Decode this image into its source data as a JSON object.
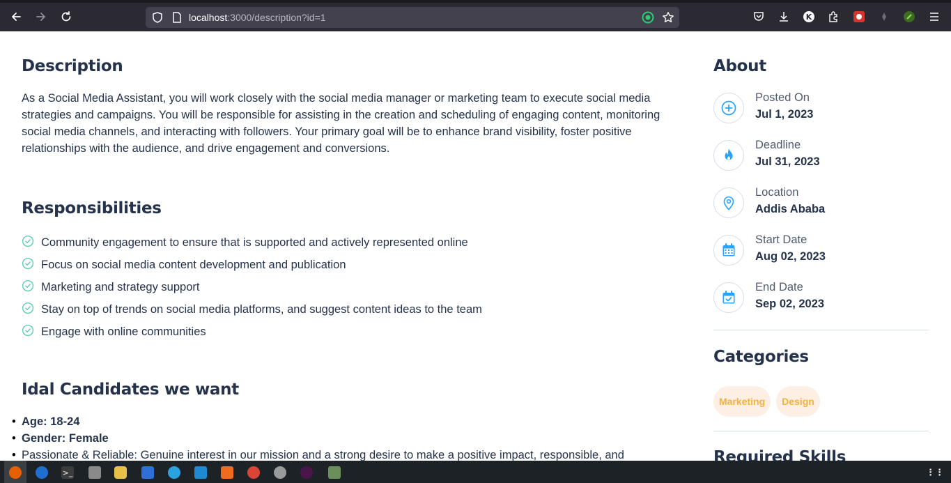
{
  "browser": {
    "url_host": "localhost",
    "url_path": ":3000/description?id=1"
  },
  "description": {
    "title": "Description",
    "text": "As a Social Media Assistant, you will work closely with the social media manager or marketing team to execute social media strategies and campaigns. You will be responsible for assisting in the creation and scheduling of engaging content, monitoring social media channels, and interacting with followers. Your primary goal will be to enhance brand visibility, foster positive relationships with the audience, and drive engagement and conversions."
  },
  "responsibilities": {
    "title": "Responsibilities",
    "items": [
      "Community engagement to ensure that is supported and actively represented online",
      "Focus on social media content development and publication",
      "Marketing and strategy support",
      "Stay on top of trends on social media platforms, and suggest content ideas to the team",
      "Engage with online communities"
    ]
  },
  "ideal": {
    "title": "Idal Candidates we want",
    "items": [
      {
        "label": "Age: 18-24",
        "text": ""
      },
      {
        "label": "Gender: Female",
        "text": ""
      },
      {
        "label": "",
        "text": "Passionate & Reliable: Genuine interest in our mission and a strong desire to make a positive impact, responsible, and"
      }
    ]
  },
  "about": {
    "title": "About",
    "items": [
      {
        "label": "Posted On",
        "value": "Jul 1, 2023",
        "icon": "plus-circle-icon"
      },
      {
        "label": "Deadline",
        "value": "Jul 31, 2023",
        "icon": "fire-icon"
      },
      {
        "label": "Location",
        "value": "Addis Ababa",
        "icon": "location-pin-icon"
      },
      {
        "label": "Start Date",
        "value": "Aug 02, 2023",
        "icon": "calendar-icon"
      },
      {
        "label": "End Date",
        "value": "Sep 02, 2023",
        "icon": "calendar-check-icon"
      }
    ]
  },
  "categories": {
    "title": "Categories",
    "tags": [
      "Marketing",
      "Design"
    ]
  },
  "skills": {
    "title": "Required Skills"
  },
  "colors": {
    "accent": "#26a4ff",
    "check": "#56cdad",
    "heading": "#25324b",
    "tag_bg": "#fdefe3",
    "tag_text": "#f5b23c"
  }
}
